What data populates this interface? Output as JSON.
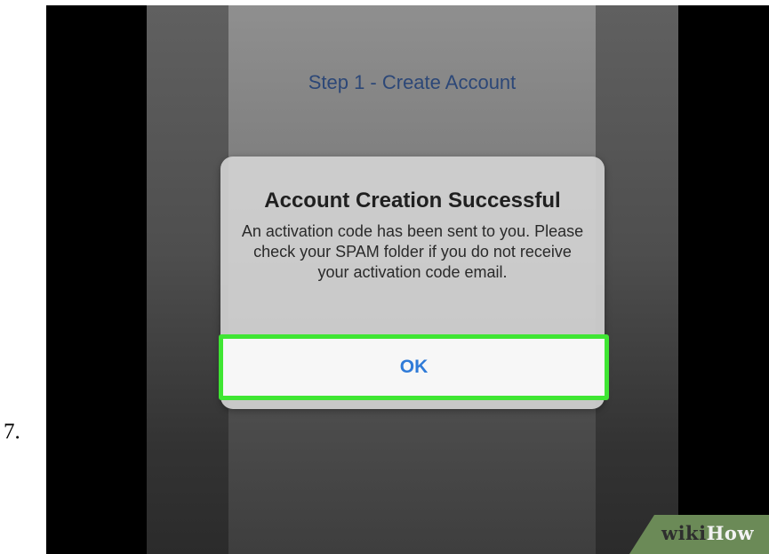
{
  "step": {
    "number": "7."
  },
  "screen": {
    "step_title": "Step 1 - Create Account"
  },
  "alert": {
    "title": "Account Creation Successful",
    "message": "An activation code has been sent to you. Please check your SPAM folder if you do not receive your activation code email.",
    "ok_label": "OK"
  },
  "watermark": {
    "part1": "wiki",
    "part2": "How"
  },
  "colors": {
    "highlight": "#3fe633",
    "ok_text": "#2f7bd8",
    "step_title_text": "#2c4777",
    "watermark_bg": "#6b8a57"
  }
}
